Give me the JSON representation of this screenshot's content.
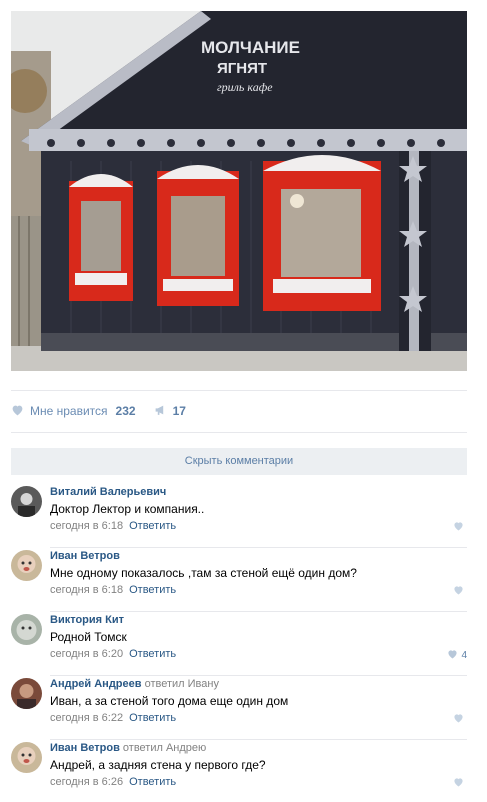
{
  "post": {
    "photo_sign_line1": "МОЛЧАНИЕ",
    "photo_sign_line2": "ЯГНЯТ",
    "photo_sign_line3": "гриль кафе"
  },
  "actions": {
    "like_label": "Мне нравится",
    "like_count": "232",
    "share_count": "17"
  },
  "hide_comments_label": "Скрыть комментарии",
  "comments": [
    {
      "author": "Виталий Валерьевич",
      "replied_to": "",
      "text": "Доктор Лектор и компания..",
      "time": "сегодня в 6:18",
      "reply_label": "Ответить",
      "likes": ""
    },
    {
      "author": "Иван Ветров",
      "replied_to": "",
      "text": "Мне одному показалось ,там за стеной ещё один дом?",
      "time": "сегодня в 6:18",
      "reply_label": "Ответить",
      "likes": ""
    },
    {
      "author": "Виктория Кит",
      "replied_to": "",
      "text": "Родной Томск",
      "time": "сегодня в 6:20",
      "reply_label": "Ответить",
      "likes": "4"
    },
    {
      "author": "Андрей Андреев",
      "replied_to": "ответил Ивану",
      "text": "Иван, а за стеной того дома еще один дом",
      "time": "сегодня в 6:22",
      "reply_label": "Ответить",
      "likes": ""
    },
    {
      "author": "Иван Ветров",
      "replied_to": "ответил Андрею",
      "text": "Андрей, а задняя стена у первого где?",
      "time": "сегодня в 6:26",
      "reply_label": "Ответить",
      "likes": ""
    }
  ],
  "colors": {
    "link": "#2a5885",
    "accent": "#5b7ea6",
    "muted": "#828282",
    "separator": "#e7e8ec",
    "hide_bar": "#eceff2",
    "house_wood": "#2c2e3a",
    "window_frame": "#d8291b"
  },
  "icons": [
    "heart-icon",
    "megaphone-icon"
  ]
}
